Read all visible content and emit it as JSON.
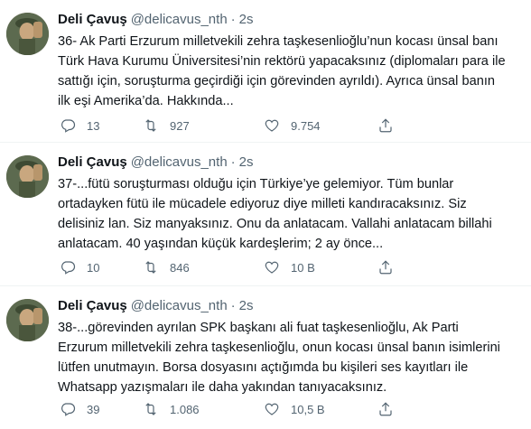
{
  "tweets": [
    {
      "name": "Deli Çavuş",
      "handle": "@delicavus_nth",
      "separator": "·",
      "time": "2s",
      "text": "36- Ak Parti Erzurum milletvekili zehra taşkesenlioğlu’nun kocası ünsal banı\nTürk Hava Kurumu Üniversitesi’nin rektörü yapacaksınız (diplomaları para ile\nsattığı için, soruşturma geçirdiği için görevinden ayrıldı). Ayrıca ünsal banın\nilk eşi Amerika’da. Hakkında...",
      "replies": "13",
      "retweets": "927",
      "likes": "9.754"
    },
    {
      "name": "Deli Çavuş",
      "handle": "@delicavus_nth",
      "separator": "·",
      "time": "2s",
      "text": "37-...fütü soruşturması olduğu için Türkiye’ye gelemiyor. Tüm bunlar\nortadayken fütü ile mücadele ediyoruz diye milleti kandıracaksınız. Siz\ndelisiniz lan. Siz manyaksınız. Onu da anlatacam. Vallahi anlatacam billahi\nanlatacam. 40 yaşından küçük kardeşlerim; 2 ay önce...",
      "replies": "10",
      "retweets": "846",
      "likes": "10 B"
    },
    {
      "name": "Deli Çavuş",
      "handle": "@delicavus_nth",
      "separator": "·",
      "time": "2s",
      "text": "38-...görevinden ayrılan SPK başkanı ali fuat taşkesenlioğlu, Ak Parti\nErzurum milletvekili zehra taşkesenlioğlu, onun kocası ünsal banın isimlerini\nlütfen unutmayın. Borsa dosyasını açtığımda bu kişileri ses kayıtları ile\nWhatsapp yazışmaları ile daha yakından tanıyacaksınız.",
      "replies": "39",
      "retweets": "1.086",
      "likes": "10,5 B"
    }
  ],
  "icons": {
    "reply": "reply-icon",
    "retweet": "retweet-icon",
    "like": "heart-icon",
    "share": "share-icon"
  },
  "colors": {
    "text": "#0f1419",
    "secondary": "#536471",
    "divider": "#eff3f4"
  }
}
